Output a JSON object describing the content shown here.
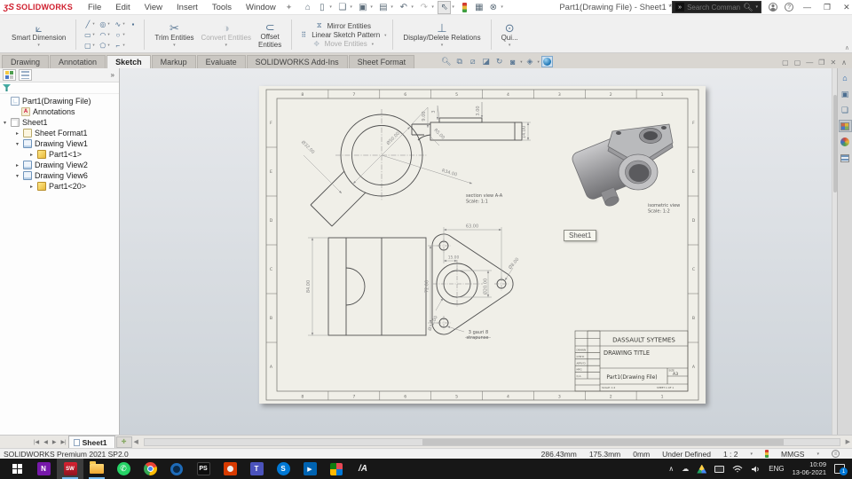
{
  "titlebar": {
    "logo": "SOLIDWORKS",
    "menus": [
      "File",
      "Edit",
      "View",
      "Insert",
      "Tools",
      "Window"
    ],
    "title": "Part1(Drawing File) - Sheet1 *",
    "search_placeholder": "Search Commands"
  },
  "ribbon": {
    "smart_dimension": "Smart Dimension",
    "trim_entities": "Trim Entities",
    "convert_entities": "Convert Entities",
    "offset_entities": "Offset\nEntities",
    "mirror_entities": "Mirror Entities",
    "linear_sketch_pattern": "Linear Sketch Pattern",
    "move_entities": "Move Entities",
    "display_delete_relations": "Display/Delete Relations",
    "quick_snaps": "Qui..."
  },
  "tabs": [
    "Drawing",
    "Annotation",
    "Sketch",
    "Markup",
    "Evaluate",
    "SOLIDWORKS Add-Ins",
    "Sheet Format"
  ],
  "tree": {
    "root": "Part1(Drawing File)",
    "annotations": "Annotations",
    "sheet1": "Sheet1",
    "sheet_format1": "Sheet Format1",
    "view1": "Drawing View1",
    "part1_1": "Part1<1>",
    "view2": "Drawing View2",
    "view6": "Drawing View6",
    "part1_20": "Part1<20>"
  },
  "sheet": {
    "zones_h": [
      "8",
      "7",
      "6",
      "5",
      "4",
      "3",
      "2",
      "1"
    ],
    "zones_v": [
      "F",
      "E",
      "D",
      "C",
      "B",
      "A"
    ],
    "section": {
      "label": "section view A-A",
      "scale": "Scale: 1:1",
      "dia50": "Ø50.00",
      "dia32": "Ø32.00",
      "r34": "R34.00",
      "r5": "R5.00",
      "d9": "9.00",
      "d3": "3",
      "d3b": "3.00",
      "d14": "14.00"
    },
    "iso": {
      "label": "isometric view",
      "scale": "Scale: 1:2"
    },
    "front": {
      "d84": "84.00",
      "d63": "63.00",
      "d15": "15.00",
      "d72": "72.00",
      "dia20": "Ø20.00",
      "dia32": "Ø32.00",
      "dia8": "Ø8.00",
      "note1": "3 gauri 8",
      "note2": "strapunse"
    },
    "titleblock": {
      "company": "DASSAULT SYTEMES",
      "title": "DRAWING TITLE",
      "doc": "Part1(Drawing File)",
      "size_label": "SIZE",
      "size": "A3",
      "r1": "DRAWN",
      "r2": "CHK'D",
      "r3": "APPV'D",
      "r4": "MFG",
      "r5": "Q.A",
      "scale": "SCALE: 1:2",
      "sheet": "SHEET 1 OF 1"
    },
    "tooltip": "Sheet1"
  },
  "sheetbar": {
    "tab": "Sheet1"
  },
  "statusbar": {
    "app": "SOLIDWORKS Premium 2021 SP2.0",
    "x": "286.43mm",
    "y": "175.3mm",
    "z": "0mm",
    "state": "Under Defined",
    "scale": "1 : 2",
    "units": "MMGS"
  },
  "taskbar": {
    "lang": "ENG",
    "time": "10:09",
    "date": "13-06-2021",
    "badge": "1"
  },
  "colors": {
    "accent": "#1c74b4",
    "sheet": "#f0efe8",
    "taskbar": "#171717",
    "logo_red": "#cf1f2e"
  }
}
